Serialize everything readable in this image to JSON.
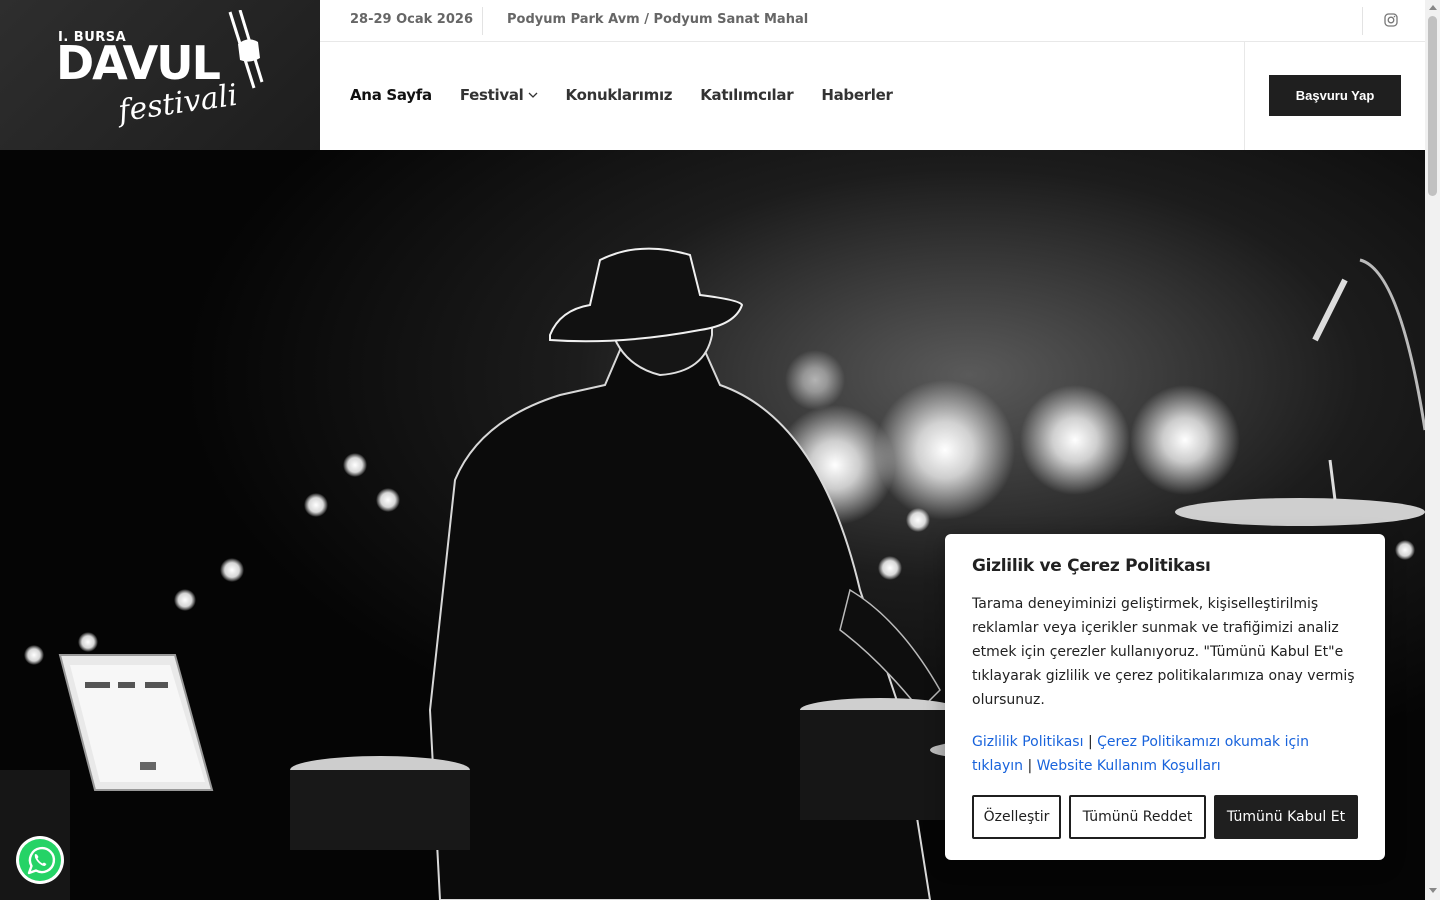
{
  "logo": {
    "small": "I. BURSA",
    "big": "DAVUL",
    "script": "festivali"
  },
  "topbar": {
    "date": "28-29 Ocak 2026",
    "venue": "Podyum Park Avm / Podyum Sanat Mahal",
    "social_icon": "instagram-icon"
  },
  "nav": {
    "items": [
      {
        "label": "Ana Sayfa"
      },
      {
        "label": "Festival"
      },
      {
        "label": "Konuklarımız"
      },
      {
        "label": "Katılımcılar"
      },
      {
        "label": "Haberler"
      }
    ],
    "apply_label": "Başvuru Yap"
  },
  "cookie": {
    "title": "Gizlilik ve Çerez Politikası",
    "text": "Tarama deneyiminizi geliştirmek, kişiselleştirilmiş reklamlar veya içerikler sunmak ve trafiğimizi analiz etmek için çerezler kullanıyoruz. \"Tümünü Kabul Et\"e tıklayarak gizlilik ve çerez politikalarımıza onay vermiş olursunuz.",
    "link_privacy": "Gizlilik Politikası",
    "link_cookie": "Çerez Politikamızı okumak için tıklayın",
    "link_terms": "Website Kullanım Koşulları",
    "separator": "|",
    "customize": "Özelleştir",
    "reject": "Tümünü Reddet",
    "accept": "Tümünü Kabul Et"
  },
  "colors": {
    "dark": "#1f1f1f",
    "link": "#1863dc",
    "whatsapp": "#25d366"
  }
}
